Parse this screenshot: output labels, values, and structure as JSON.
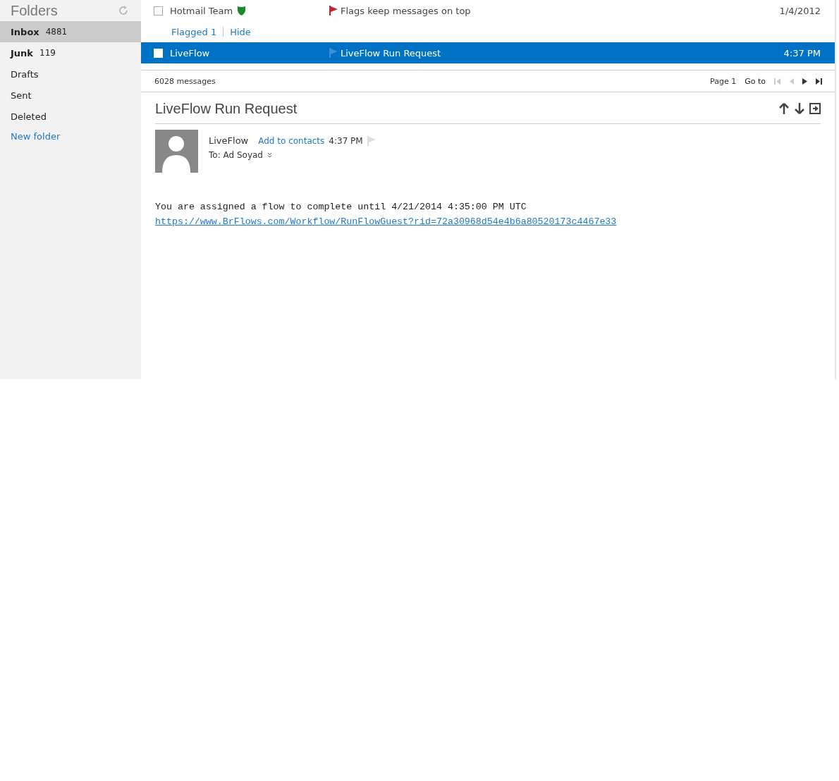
{
  "sidebar": {
    "title": "Folders",
    "folders": [
      {
        "name": "Inbox",
        "count": "4881",
        "selected": true,
        "bold": true
      },
      {
        "name": "Junk",
        "count": "119",
        "selected": false,
        "bold": true
      },
      {
        "name": "Drafts",
        "selected": false,
        "bold": false
      },
      {
        "name": "Sent",
        "selected": false,
        "bold": false
      },
      {
        "name": "Deleted",
        "selected": false,
        "bold": false
      }
    ],
    "new_folder": "New folder"
  },
  "message_list": {
    "rows": [
      {
        "kind": "message",
        "sender": "Hotmail Team",
        "verified": true,
        "flagged": true,
        "subject": "Flags keep messages on top",
        "date": "1/4/2012",
        "selected": false,
        "checked": false
      },
      {
        "kind": "flag_filter",
        "label": "Flagged 1",
        "action": "Hide"
      },
      {
        "kind": "message",
        "sender": "LiveFlow",
        "verified": false,
        "flagged": false,
        "subject": "LiveFlow Run Request",
        "date": "4:37 PM",
        "selected": true,
        "checked": false
      }
    ],
    "status": "6028 messages",
    "page": "Page 1",
    "goto": "Go to"
  },
  "reading_pane": {
    "subject": "LiveFlow Run Request",
    "sender": "LiveFlow",
    "add_contact": "Add to contacts",
    "time": "4:37 PM",
    "to": "To: Ad Soyad",
    "body": "You are assigned a flow to complete until 4/21/2014 4:35:00 PM UTC",
    "link": "https://www.BrFlows.com/Workflow/RunFlowGuest?rid=72a30968d54e4b6a80520173c4467e33"
  }
}
